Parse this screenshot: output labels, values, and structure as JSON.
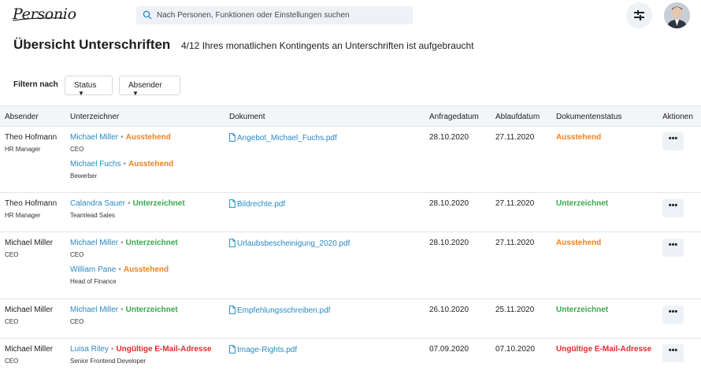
{
  "app": {
    "logo_text": "Personio"
  },
  "search": {
    "placeholder": "Nach Personen, Funktionen oder Einstellungen suchen"
  },
  "header": {
    "title": "Übersicht Unterschriften",
    "subtitle": "4/12 Ihres monatlichen Kontingents an Unterschriften ist aufgebraucht"
  },
  "filters": {
    "label": "Filtern nach",
    "status": "Status",
    "sender": "Absender"
  },
  "columns": {
    "sender": "Absender",
    "signers": "Unterzeichner",
    "document": "Dokument",
    "requested": "Anfragedatum",
    "expires": "Ablaufdatum",
    "doc_status": "Dokumentenstatus",
    "actions": "Aktionen"
  },
  "colors": {
    "pending": "#f0821d",
    "signed": "#3aa84d",
    "invalid": "#e02b2b",
    "link": "#2a8ac4"
  },
  "rows": [
    {
      "sender_name": "Theo Hofmann",
      "sender_role": "HR Manager",
      "signers": [
        {
          "name": "Michael Miller",
          "status": "Ausstehend",
          "role": "CEO"
        },
        {
          "name": "Michael Fuchs",
          "status": "Ausstehend",
          "role": "Bewerber"
        }
      ],
      "document": "Angebot_Michael_Fuchs.pdf",
      "requested": "28.10.2020",
      "expires": "27.11.2020",
      "doc_status": "Ausstehend",
      "actions": "•••"
    },
    {
      "sender_name": "Theo Hofmann",
      "sender_role": "HR Manager",
      "signers": [
        {
          "name": "Calandra Sauer",
          "status": "Unterzeichnet",
          "role": "Teamlead Sales"
        }
      ],
      "document": "Bildrechte.pdf",
      "requested": "28.10.2020",
      "expires": "27.11.2020",
      "doc_status": "Unterzeichnet",
      "actions": "•••"
    },
    {
      "sender_name": "Michael Miller",
      "sender_role": "CEO",
      "signers": [
        {
          "name": "Michael Miller",
          "status": "Unterzeichnet",
          "role": "CEO"
        },
        {
          "name": "William Pane",
          "status": "Ausstehend",
          "role": "Head of Finance"
        }
      ],
      "document": "Urlaubsbescheinigung_2020.pdf",
      "requested": "28.10.2020",
      "expires": "27.11.2020",
      "doc_status": "Ausstehend",
      "actions": "•••"
    },
    {
      "sender_name": "Michael Miller",
      "sender_role": "CEO",
      "signers": [
        {
          "name": "Michael Miller",
          "status": "Unterzeichnet",
          "role": "CEO"
        }
      ],
      "document": "Empfehlungsschreiben.pdf",
      "requested": "26.10.2020",
      "expires": "25.11.2020",
      "doc_status": "Unterzeichnet",
      "actions": "•••"
    },
    {
      "sender_name": "Michael Miller",
      "sender_role": "CEO",
      "signers": [
        {
          "name": "Luisa Riley",
          "status": "Ungültige E-Mail-Adresse",
          "role": "Senior Frontend Developer"
        }
      ],
      "document": "Image-Rights.pdf",
      "requested": "07.09.2020",
      "expires": "07.10.2020",
      "doc_status": "Ungültige E-Mail-Adresse",
      "actions": "•••"
    }
  ]
}
